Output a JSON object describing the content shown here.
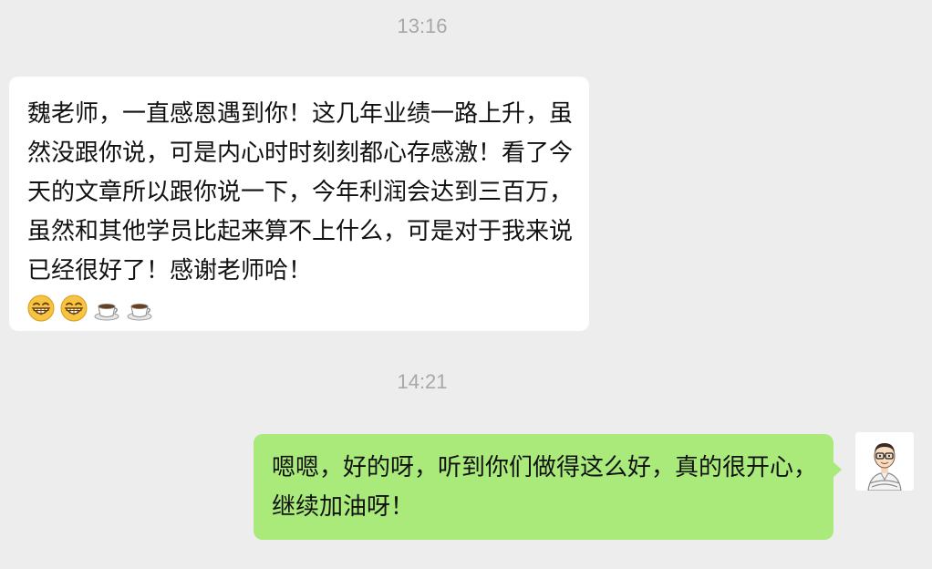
{
  "chat": {
    "messages": [
      {
        "timestamp": "13:16",
        "direction": "incoming",
        "text": "魏老师，一直感恩遇到你！这几年业绩一路上升，虽然没跟你说，可是内心时时刻刻都心存感激！看了今天的文章所以跟你说一下，今年利润会达到三百万，虽然和其他学员比起来算不上什么，可是对于我来说已经很好了！感谢老师哈！",
        "emojis": [
          "grin-emoji",
          "grin-emoji",
          "coffee-emoji",
          "coffee-emoji"
        ]
      },
      {
        "timestamp": "14:21",
        "direction": "outgoing",
        "text": "嗯嗯，好的呀，听到你们做得这么好，真的很开心，继续加油呀！",
        "avatar": "teacher-cartoon-avatar"
      }
    ]
  },
  "colors": {
    "background": "#ededed",
    "incoming_bubble": "#ffffff",
    "outgoing_bubble": "#a9ea7a",
    "timestamp_text": "#a8a8a8"
  }
}
